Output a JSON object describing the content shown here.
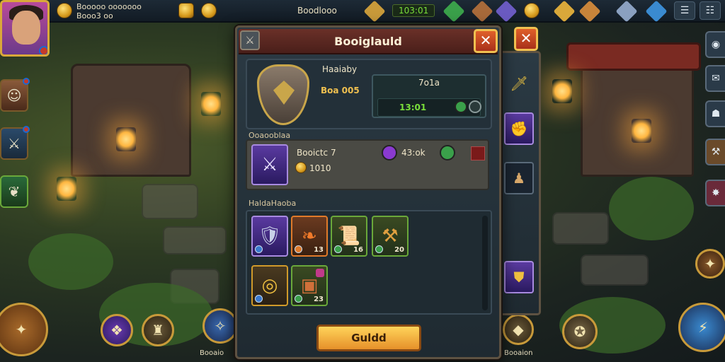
{
  "top_bar": {
    "player_text": "Booooo ooooooo",
    "player_sub": "Booo3 oo",
    "center_label": "Boodlooo",
    "resource_value": "103:01"
  },
  "panel": {
    "title": "Booiglauld",
    "guild_label": "Haaiaby",
    "guild_value": "Boa 005",
    "stat_top": "7o1a",
    "stat_bottom": "13:01",
    "craft_section_label": "Ooaooblaa",
    "craft_item_name": "Booictc 7",
    "craft_item_cost": "1010",
    "craft_item_value": "43:ok",
    "inventory_label": "HaldaHaoba",
    "inventory": [
      {
        "icon": "bracer-icon",
        "count": "",
        "color": "purple"
      },
      {
        "icon": "feather-icon",
        "count": "13",
        "color": "orange"
      },
      {
        "icon": "scroll-icon",
        "count": "16",
        "color": "green"
      },
      {
        "icon": "hammer-icon",
        "count": "20",
        "color": "green"
      },
      {
        "icon": "rings-icon",
        "count": "",
        "color": "gold"
      },
      {
        "icon": "chest-icon",
        "count": "23",
        "color": "green"
      }
    ],
    "action_button": "Guldd"
  },
  "bottom_labels": {
    "left": "Booaio",
    "right": "Booaion"
  },
  "colors": {
    "accent_gold": "#f0c050",
    "title_red": "#6a3028",
    "panel_bg": "#2b3a44",
    "stat_green": "#7adf3a"
  }
}
